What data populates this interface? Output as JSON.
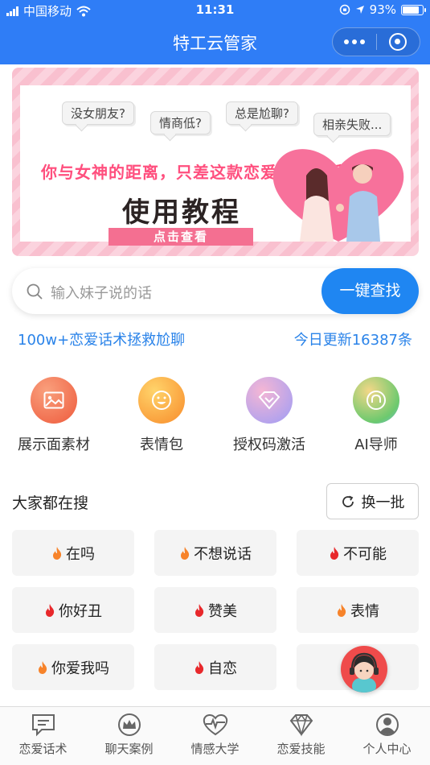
{
  "status": {
    "carrier": "中国移动",
    "time": "11:31",
    "battery": "93%",
    "battery_level": 0.93
  },
  "navbar": {
    "title": "特工云管家"
  },
  "banner": {
    "bubbles": [
      "没女朋友?",
      "情商低?",
      "总是尬聊?",
      "相亲失败..."
    ],
    "headline": "你与女神的距离，只差这款恋爱聊天助手",
    "course_title": "使用教程",
    "cta": "点击查看"
  },
  "search": {
    "placeholder": "输入妹子说的话",
    "button": "一键查找"
  },
  "info": {
    "left": "100w+恋爱话术拯救尬聊",
    "right": "今日更新16387条"
  },
  "quick_actions": [
    {
      "label": "展示面素材",
      "icon": "image-icon",
      "color": "#f16a4a"
    },
    {
      "label": "表情包",
      "icon": "smile-icon",
      "color": "#f7a23a"
    },
    {
      "label": "授权码激活",
      "icon": "diamond-icon",
      "color": "#b497f4"
    },
    {
      "label": "AI导师",
      "icon": "headset-icon",
      "color": "#8fd16a"
    }
  ],
  "popular": {
    "title": "大家都在搜",
    "refresh": "换一批",
    "tags": [
      "在吗",
      "不想说话",
      "不可能",
      "你好丑",
      "赞美",
      "表情",
      "你爱我吗",
      "自恋",
      ""
    ]
  },
  "tabbar": [
    {
      "label": "恋爱话术",
      "icon": "chat-icon"
    },
    {
      "label": "聊天案例",
      "icon": "crown-icon"
    },
    {
      "label": "情感大学",
      "icon": "heart-pulse-icon"
    },
    {
      "label": "恋爱技能",
      "icon": "diamond-icon"
    },
    {
      "label": "个人中心",
      "icon": "person-icon"
    }
  ]
}
